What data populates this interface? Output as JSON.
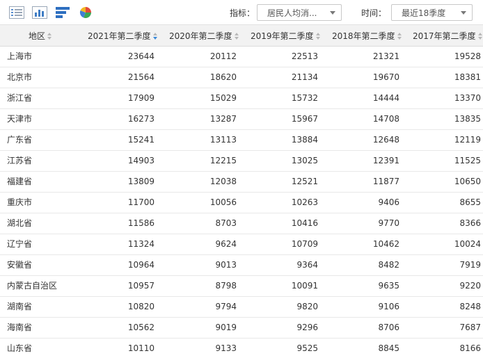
{
  "toolbar": {
    "icons": [
      "table-view-icon",
      "bar-chart-view-icon",
      "horizontal-bar-view-icon",
      "pie-chart-view-icon"
    ],
    "indicator_label": "指标：",
    "indicator_value": "居民人均消...",
    "time_label": "时间：",
    "time_value": "最近18季度"
  },
  "table": {
    "headers": [
      "地区",
      "2021年第二季度",
      "2020年第二季度",
      "2019年第二季度",
      "2018年第二季度",
      "2017年第二季度"
    ],
    "rows": [
      [
        "上海市",
        "23644",
        "20112",
        "22513",
        "21321",
        "19528"
      ],
      [
        "北京市",
        "21564",
        "18620",
        "21134",
        "19670",
        "18381"
      ],
      [
        "浙江省",
        "17909",
        "15029",
        "15732",
        "14444",
        "13370"
      ],
      [
        "天津市",
        "16273",
        "13287",
        "15967",
        "14708",
        "13835"
      ],
      [
        "广东省",
        "15241",
        "13113",
        "13884",
        "12648",
        "12119"
      ],
      [
        "江苏省",
        "14903",
        "12215",
        "13025",
        "12391",
        "11525"
      ],
      [
        "福建省",
        "13809",
        "12038",
        "12521",
        "11877",
        "10650"
      ],
      [
        "重庆市",
        "11700",
        "10056",
        "10263",
        "9406",
        "8655"
      ],
      [
        "湖北省",
        "11586",
        "8703",
        "10416",
        "9770",
        "8366"
      ],
      [
        "辽宁省",
        "11324",
        "9624",
        "10709",
        "10462",
        "10024"
      ],
      [
        "安徽省",
        "10964",
        "9013",
        "9364",
        "8482",
        "7919"
      ],
      [
        "内蒙古自治区",
        "10957",
        "8798",
        "10091",
        "9635",
        "9220"
      ],
      [
        "湖南省",
        "10820",
        "9794",
        "9820",
        "9106",
        "8248"
      ],
      [
        "海南省",
        "10562",
        "9019",
        "9296",
        "8706",
        "7687"
      ],
      [
        "山东省",
        "10110",
        "9133",
        "9525",
        "8845",
        "8166"
      ]
    ]
  }
}
